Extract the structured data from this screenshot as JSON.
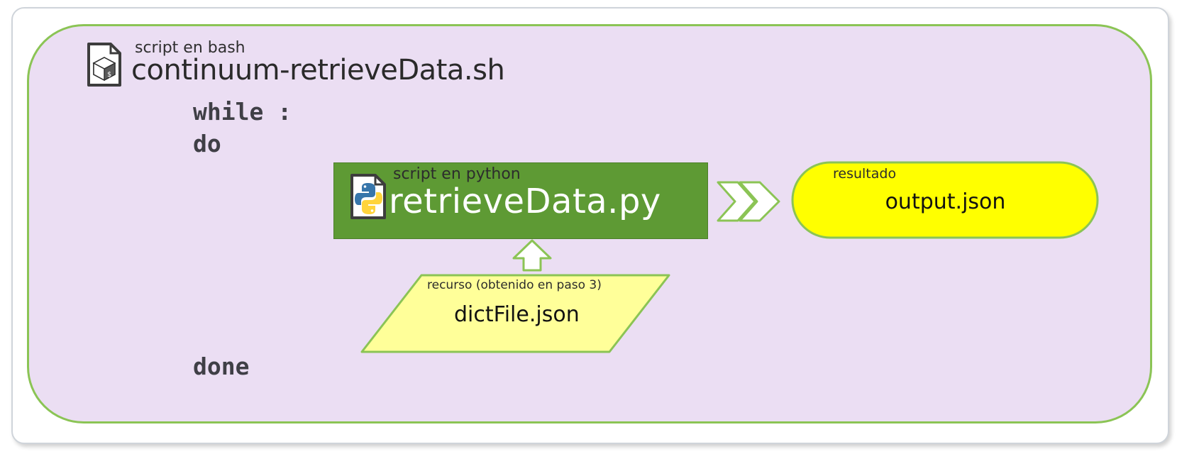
{
  "bash_script": {
    "kind_label": "script en bash",
    "name": "continuum-retrieveData.sh",
    "icon": "bash-script-file-icon"
  },
  "code": {
    "while_line": "while :",
    "do_line": "do",
    "done_line": "done"
  },
  "python_script": {
    "kind_label": "script en python",
    "name": "retrieveData.py",
    "icon": "python-file-icon"
  },
  "resource": {
    "kind_label": "recurso (obtenido en paso 3)",
    "name": "dictFile.json"
  },
  "result": {
    "kind_label": "resultado",
    "name": "output.json"
  },
  "colors": {
    "outer_fill": "#ebdef3",
    "outer_border": "#8bc455",
    "python_box": "#5e9a34",
    "result_fill": "#ffff00",
    "resource_fill": "#ffff99",
    "arrow_fill": "#ffffff",
    "arrow_stroke": "#8bc455"
  }
}
